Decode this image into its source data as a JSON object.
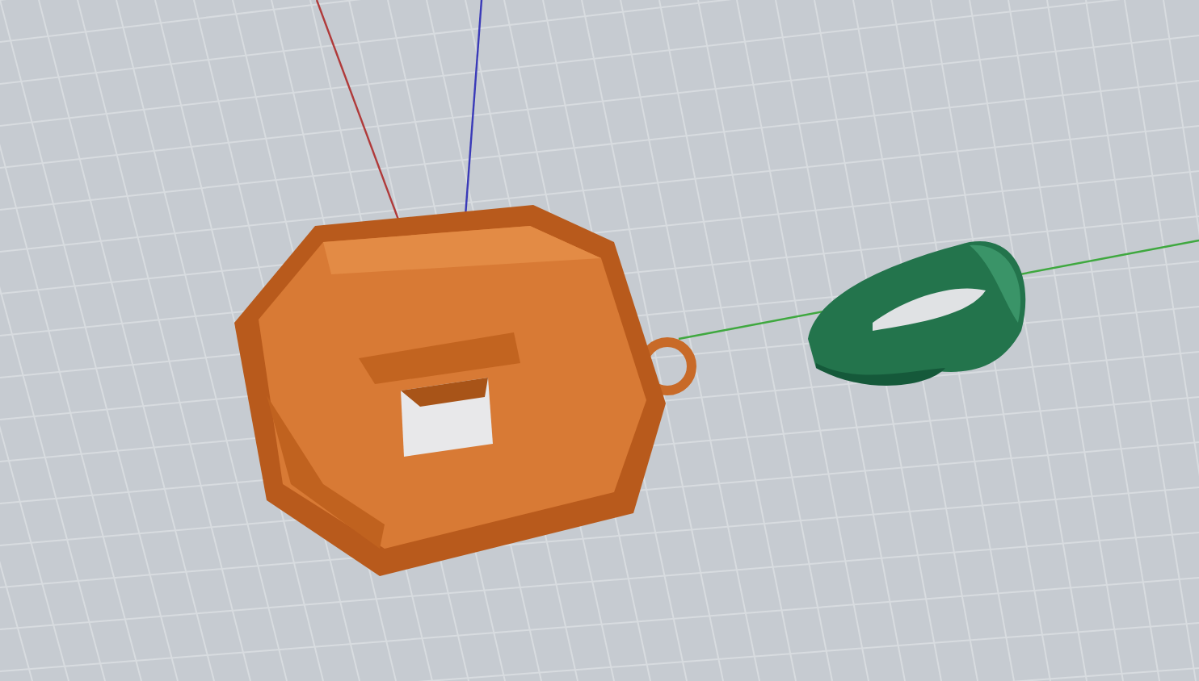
{
  "viewport": {
    "axes": [
      {
        "kind": "x"
      },
      {
        "kind": "y"
      },
      {
        "kind": "z"
      }
    ],
    "objects": [
      {
        "kind": "pendant"
      },
      {
        "kind": "ring"
      }
    ]
  }
}
